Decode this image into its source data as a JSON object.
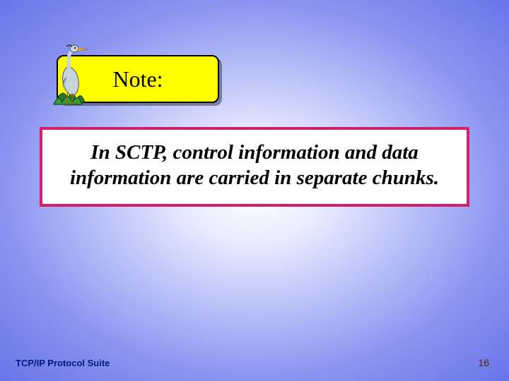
{
  "note": {
    "label": "Note:"
  },
  "content": {
    "body": "In SCTP, control information and data information are carried in separate chunks."
  },
  "footer": {
    "left": "TCP/IP Protocol Suite",
    "page": "16"
  },
  "icons": {
    "heron": "heron-icon"
  }
}
